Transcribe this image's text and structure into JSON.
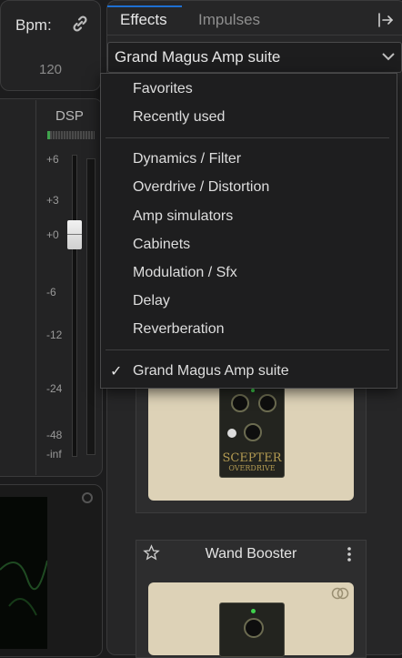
{
  "bpm": {
    "label": "Bpm:",
    "value": "120"
  },
  "meter": {
    "label": "DSP",
    "scale": [
      "+6",
      "+3",
      "+0",
      "-6",
      "-12",
      "-24",
      "-48",
      "-inf"
    ],
    "fader_level_db": 0
  },
  "tabs": {
    "effects": "Effects",
    "impulses": "Impulses"
  },
  "selector": {
    "value": "Grand Magus Amp suite"
  },
  "menu": {
    "group1": [
      "Favorites",
      "Recently used"
    ],
    "group2": [
      "Dynamics / Filter",
      "Overdrive / Distortion",
      "Amp simulators",
      "Cabinets",
      "Modulation / Sfx",
      "Delay",
      "Reverberation"
    ],
    "group3": [
      "Grand Magus Amp suite"
    ],
    "checkmark": "✓"
  },
  "cards": [
    {
      "pedal_title": "SCEPTER",
      "pedal_subtitle": "OVERDRIVE"
    },
    {
      "title": "Wand Booster"
    }
  ],
  "colors": {
    "accent": "#1e6fd1",
    "pedal_bg": "#ddd2b7",
    "pedal_text": "#b39b52"
  },
  "icons": {
    "bpm_link": "link-icon",
    "export": "export-icon",
    "chevron": "chevron-down-icon",
    "star": "star-icon",
    "more": "kebab-icon",
    "linked": "linked-rings-icon"
  }
}
